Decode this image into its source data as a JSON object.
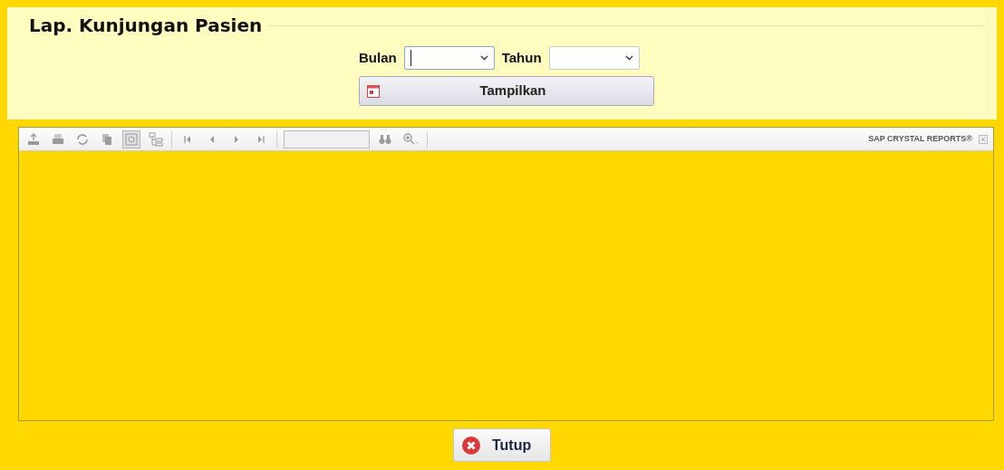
{
  "form": {
    "title": "Lap. Kunjungan Pasien",
    "fields": [
      {
        "label": "Bulan",
        "focused": true
      },
      {
        "label": "Tahun",
        "focused": false
      }
    ],
    "show_button": {
      "label": "Tampilkan"
    }
  },
  "viewer": {
    "toolbar": {
      "tools": [
        {
          "kind": "export"
        },
        {
          "kind": "print"
        },
        {
          "kind": "refresh"
        },
        {
          "kind": "copy"
        },
        {
          "kind": "help",
          "selected": true
        },
        {
          "kind": "tree",
          "selected": false
        },
        {
          "kind": "sep"
        },
        {
          "kind": "first"
        },
        {
          "kind": "prev"
        },
        {
          "kind": "next"
        },
        {
          "kind": "last"
        },
        {
          "kind": "sep"
        },
        {
          "kind": "page"
        },
        {
          "kind": "find"
        },
        {
          "kind": "zoom"
        },
        {
          "kind": "sep"
        }
      ],
      "brand": "SAP CRYSTAL REPORTS®"
    }
  },
  "close_button": {
    "label": "Tutup"
  }
}
